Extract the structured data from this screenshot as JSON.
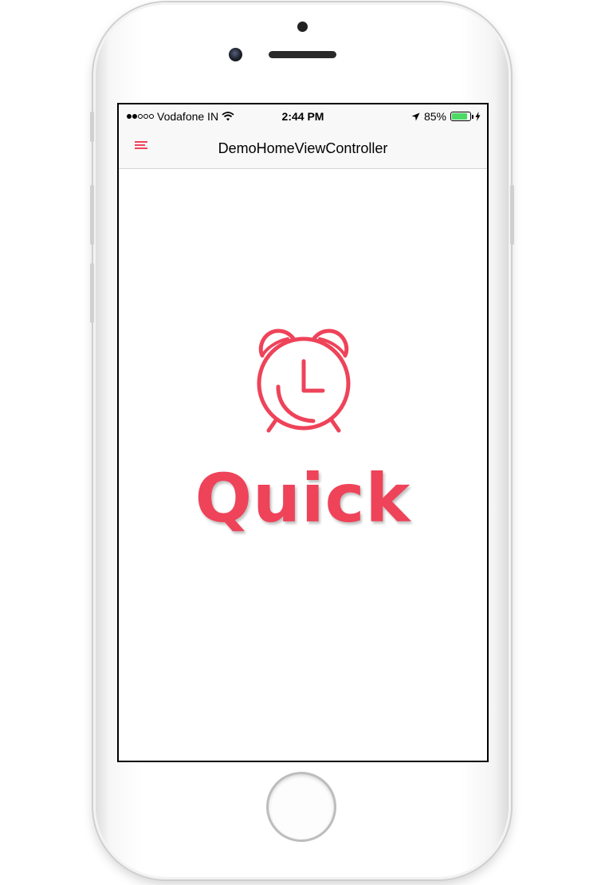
{
  "status_bar": {
    "carrier": "Vodafone IN",
    "time": "2:44 PM",
    "battery_percent": "85%",
    "signal_bars_filled": 2,
    "signal_bars_total": 5,
    "battery_level": 0.85,
    "battery_color": "#4cd964"
  },
  "nav_bar": {
    "title": "DemoHomeViewController",
    "menu_icon": "hamburger-menu-icon"
  },
  "content": {
    "logo_icon": "alarm-clock-icon",
    "logo_text": "Quick"
  },
  "colors": {
    "accent": "#ee4359",
    "nav_background": "#f8f8f8"
  }
}
